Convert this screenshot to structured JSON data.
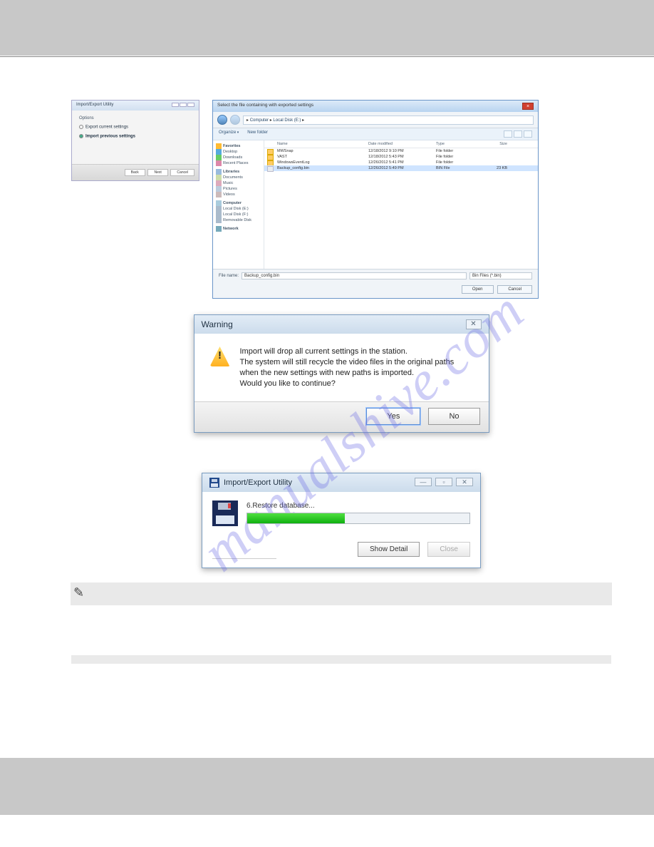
{
  "watermark": "manualshive.com",
  "small_dialog": {
    "title": "Import/Export Utility",
    "section": "Options",
    "opt_export": "Export current settings",
    "opt_import": "Import previous settings",
    "btn_back": "Back",
    "btn_next": "Next",
    "btn_cancel": "Cancel"
  },
  "file_picker": {
    "title": "Select the file containing with exported settings",
    "breadcrumb": {
      "a": "Computer",
      "b": "Local Disk (E:)"
    },
    "toolbar": {
      "organize": "Organize",
      "newfolder": "New folder"
    },
    "sidebar": {
      "favorites": "Favorites",
      "desktop": "Desktop",
      "downloads": "Downloads",
      "recent": "Recent Places",
      "libraries": "Libraries",
      "documents": "Documents",
      "music": "Music",
      "pictures": "Pictures",
      "videos": "Videos",
      "computer": "Computer",
      "local_e": "Local Disk (E:)",
      "local_f": "Local Disk (F:)",
      "removable": "Removable Disk",
      "network": "Network"
    },
    "headers": {
      "name": "Name",
      "date": "Date modified",
      "type": "Type",
      "size": "Size"
    },
    "rows": [
      {
        "name": "MWSnap",
        "date": "12/18/2012 9:10 PM",
        "type": "File folder",
        "size": ""
      },
      {
        "name": "VAST",
        "date": "12/18/2012 5:43 PM",
        "type": "File folder",
        "size": ""
      },
      {
        "name": "WindowsEventLog",
        "date": "12/26/2012 5:41 PM",
        "type": "File folder",
        "size": ""
      },
      {
        "name": "Backup_config.bin",
        "date": "12/26/2012 5:49 PM",
        "type": "BIN File",
        "size": "23 KB"
      }
    ],
    "filebar": {
      "label": "File name:",
      "value": "Backup_config.bin",
      "filter": "Bin Files (*.bin)"
    },
    "btn_open": "Open",
    "btn_cancel": "Cancel"
  },
  "warning": {
    "title": "Warning",
    "line1": "Import will drop all current settings in the station.",
    "line2": "The system will still recycle the video files in the original paths when the new settings with new paths is imported.",
    "line3": "Would you like to continue?",
    "btn_yes": "Yes",
    "btn_no": "No"
  },
  "progress": {
    "title": "Import/Export Utility",
    "status": "6.Restore database...",
    "btn_detail": "Show Detail",
    "btn_close": "Close"
  }
}
